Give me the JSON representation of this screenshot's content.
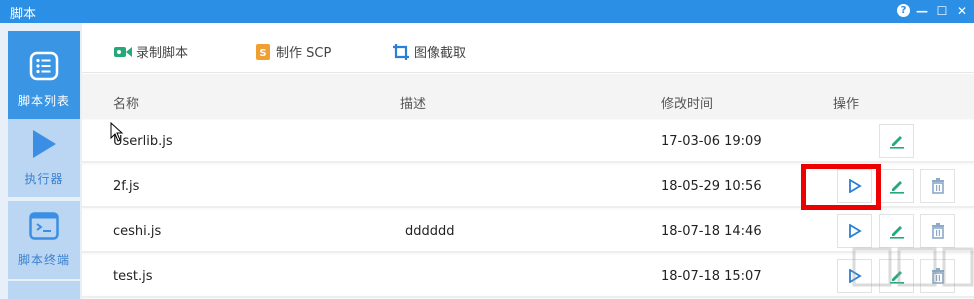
{
  "window": {
    "title": "脚本",
    "help_glyph": "?",
    "minimize_glyph": "—",
    "maximize_glyph": "☐",
    "close_glyph": "✕"
  },
  "sidebar": {
    "items": [
      {
        "label": "脚本列表",
        "icon": "list-icon",
        "active": true
      },
      {
        "label": "执行器",
        "icon": "play-icon",
        "active": false
      },
      {
        "label": "脚本终端",
        "icon": "terminal-icon",
        "active": false
      }
    ]
  },
  "toolbar": {
    "record_label": "录制脚本",
    "scp_label": "制作 SCP",
    "capture_label": "图像截取"
  },
  "table": {
    "columns": [
      "名称",
      "描述",
      "修改时间",
      "操作"
    ],
    "rows": [
      {
        "name": "Userlib.js",
        "desc": "",
        "modified": "17-03-06 19:09",
        "actions": [
          "edit"
        ]
      },
      {
        "name": "2f.js",
        "desc": "",
        "modified": "18-05-29 10:56",
        "actions": [
          "run",
          "edit",
          "delete"
        ]
      },
      {
        "name": "ceshi.js",
        "desc": "dddddd",
        "modified": "18-07-18 14:46",
        "actions": [
          "run",
          "edit",
          "delete"
        ]
      },
      {
        "name": "test.js",
        "desc": "",
        "modified": "18-07-18 15:07",
        "actions": [
          "run",
          "edit",
          "delete"
        ]
      }
    ]
  },
  "colors": {
    "titlebar": "#2c8fe6",
    "sidebar_active": "#3b95e5",
    "sidebar_normal": "#bad6f2",
    "run_icon": "#2b7fd6",
    "edit_icon": "#27a87a",
    "delete_icon": "#8ba9c8",
    "highlight": "#e00000"
  }
}
